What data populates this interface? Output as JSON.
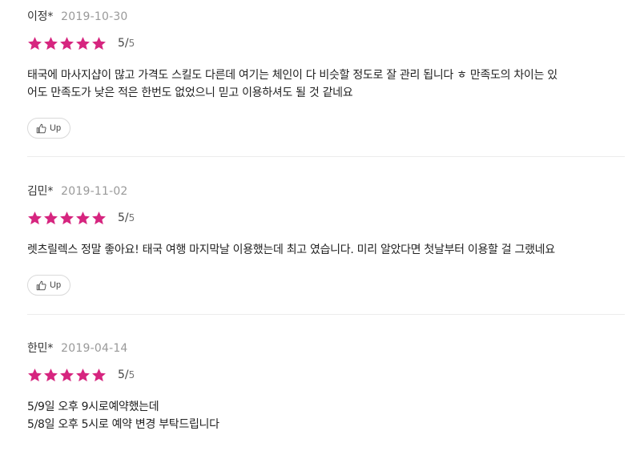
{
  "reviews": [
    {
      "name": "이정*",
      "date": "2019-10-30",
      "score": "5/",
      "score_max": "5",
      "stars": 5,
      "body": "태국에 마사지샵이 많고 가격도 스킬도 다른데 여기는 체인이 다 비슷할 정도로 잘 관리 됩니다 ㅎ 만족도의 차이는 있\n어도 만족도가 낮은 적은 한번도 없었으니 믿고 이용하셔도 될 것 같네요",
      "up_label": "Up"
    },
    {
      "name": "김민*",
      "date": "2019-11-02",
      "score": "5/",
      "score_max": "5",
      "stars": 5,
      "body": "렛츠릴렉스 정말 좋아요! 태국 여행 마지막날 이용했는데 최고 였습니다. 미리 알았다면 첫날부터 이용할 걸 그랬네요",
      "up_label": "Up"
    },
    {
      "name": "한민*",
      "date": "2019-04-14",
      "score": "5/",
      "score_max": "5",
      "stars": 5,
      "body": "5/9일 오후 9시로예약했는데\n5/8일 오후 5시로 예약 변경 부탁드립니다"
    }
  ],
  "colors": {
    "star": "#d6257f",
    "date": "#999999",
    "divider": "#ececec"
  },
  "icons": {
    "star": "star-icon",
    "up": "thumbs-up-icon"
  }
}
